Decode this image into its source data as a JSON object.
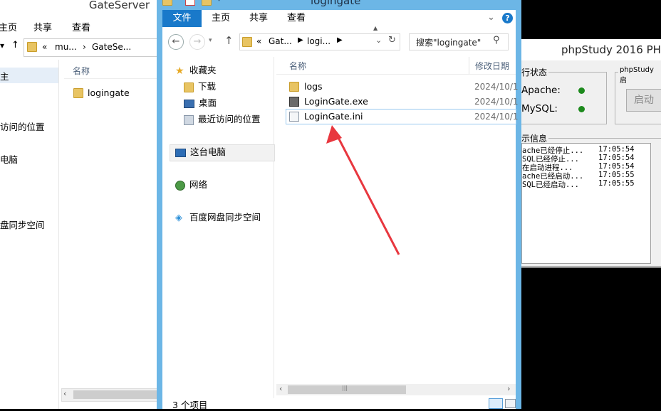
{
  "back_window": {
    "title": "GateServer",
    "ribbon": [
      "主页",
      "共享",
      "查看"
    ],
    "ribbon_first_partial": "主页",
    "address": [
      "«",
      "mu...",
      "GateSe..."
    ],
    "nav_items": [
      "访问的位置",
      "电脑",
      "盘同步空间"
    ],
    "nav_first_partial": "主页",
    "column_name": "名称",
    "files": [
      "logingate"
    ]
  },
  "phpstudy": {
    "title": "phpStudy 2016  PH",
    "status_group": "行状态",
    "apache": "Apache:",
    "mysql": "MySQL:",
    "mode_group": "phpStudy 启",
    "start_button": "启动",
    "log_group": "示信息",
    "log": [
      {
        "text": "ache已经停止...",
        "time": "17:05:54"
      },
      {
        "text": "SQL已经停止...",
        "time": "17:05:54"
      },
      {
        "text": "在启动进程...",
        "time": "17:05:54"
      },
      {
        "text": "ache已经启动...",
        "time": "17:05:55"
      },
      {
        "text": "SQL已经启动...",
        "time": "17:05:55"
      }
    ],
    "colors": {
      "running": "#1d8a1d"
    }
  },
  "main_window": {
    "title": "logingate",
    "tabs": [
      "文件",
      "主页",
      "共享",
      "查看"
    ],
    "address": [
      "«",
      "Gat...",
      "logi...",
      "›"
    ],
    "search_placeholder": "搜索\"logingate\"",
    "nav": {
      "favorites": "收藏夹",
      "downloads": "下载",
      "desktop": "桌面",
      "recent": "最近访问的位置",
      "this_pc": "这台电脑",
      "network": "网络",
      "baidu": "百度网盘同步空间"
    },
    "columns": {
      "name": "名称",
      "date": "修改日期"
    },
    "files": [
      {
        "name": "logs",
        "date": "2024/10/1",
        "type": "folder"
      },
      {
        "name": "LoginGate.exe",
        "date": "2024/10/1",
        "type": "exe"
      },
      {
        "name": "LoginGate.ini",
        "date": "2024/10/1",
        "type": "ini"
      }
    ],
    "status": "3 个项目",
    "colors": {
      "accent": "#1979ca",
      "frame": "#6cb6e6",
      "arrow": "#e8373f"
    }
  }
}
